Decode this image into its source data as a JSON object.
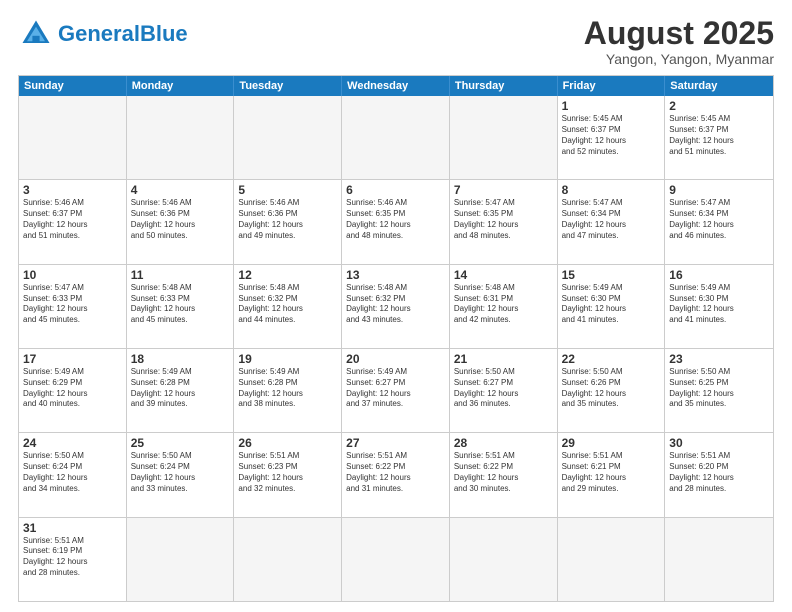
{
  "header": {
    "logo_general": "General",
    "logo_blue": "Blue",
    "month_title": "August 2025",
    "location": "Yangon, Yangon, Myanmar"
  },
  "weekdays": [
    "Sunday",
    "Monday",
    "Tuesday",
    "Wednesday",
    "Thursday",
    "Friday",
    "Saturday"
  ],
  "weeks": [
    [
      {
        "day": "",
        "info": "",
        "empty": true
      },
      {
        "day": "",
        "info": "",
        "empty": true
      },
      {
        "day": "",
        "info": "",
        "empty": true
      },
      {
        "day": "",
        "info": "",
        "empty": true
      },
      {
        "day": "",
        "info": "",
        "empty": true
      },
      {
        "day": "1",
        "info": "Sunrise: 5:45 AM\nSunset: 6:37 PM\nDaylight: 12 hours\nand 52 minutes."
      },
      {
        "day": "2",
        "info": "Sunrise: 5:45 AM\nSunset: 6:37 PM\nDaylight: 12 hours\nand 51 minutes."
      }
    ],
    [
      {
        "day": "3",
        "info": "Sunrise: 5:46 AM\nSunset: 6:37 PM\nDaylight: 12 hours\nand 51 minutes."
      },
      {
        "day": "4",
        "info": "Sunrise: 5:46 AM\nSunset: 6:36 PM\nDaylight: 12 hours\nand 50 minutes."
      },
      {
        "day": "5",
        "info": "Sunrise: 5:46 AM\nSunset: 6:36 PM\nDaylight: 12 hours\nand 49 minutes."
      },
      {
        "day": "6",
        "info": "Sunrise: 5:46 AM\nSunset: 6:35 PM\nDaylight: 12 hours\nand 48 minutes."
      },
      {
        "day": "7",
        "info": "Sunrise: 5:47 AM\nSunset: 6:35 PM\nDaylight: 12 hours\nand 48 minutes."
      },
      {
        "day": "8",
        "info": "Sunrise: 5:47 AM\nSunset: 6:34 PM\nDaylight: 12 hours\nand 47 minutes."
      },
      {
        "day": "9",
        "info": "Sunrise: 5:47 AM\nSunset: 6:34 PM\nDaylight: 12 hours\nand 46 minutes."
      }
    ],
    [
      {
        "day": "10",
        "info": "Sunrise: 5:47 AM\nSunset: 6:33 PM\nDaylight: 12 hours\nand 45 minutes."
      },
      {
        "day": "11",
        "info": "Sunrise: 5:48 AM\nSunset: 6:33 PM\nDaylight: 12 hours\nand 45 minutes."
      },
      {
        "day": "12",
        "info": "Sunrise: 5:48 AM\nSunset: 6:32 PM\nDaylight: 12 hours\nand 44 minutes."
      },
      {
        "day": "13",
        "info": "Sunrise: 5:48 AM\nSunset: 6:32 PM\nDaylight: 12 hours\nand 43 minutes."
      },
      {
        "day": "14",
        "info": "Sunrise: 5:48 AM\nSunset: 6:31 PM\nDaylight: 12 hours\nand 42 minutes."
      },
      {
        "day": "15",
        "info": "Sunrise: 5:49 AM\nSunset: 6:30 PM\nDaylight: 12 hours\nand 41 minutes."
      },
      {
        "day": "16",
        "info": "Sunrise: 5:49 AM\nSunset: 6:30 PM\nDaylight: 12 hours\nand 41 minutes."
      }
    ],
    [
      {
        "day": "17",
        "info": "Sunrise: 5:49 AM\nSunset: 6:29 PM\nDaylight: 12 hours\nand 40 minutes."
      },
      {
        "day": "18",
        "info": "Sunrise: 5:49 AM\nSunset: 6:28 PM\nDaylight: 12 hours\nand 39 minutes."
      },
      {
        "day": "19",
        "info": "Sunrise: 5:49 AM\nSunset: 6:28 PM\nDaylight: 12 hours\nand 38 minutes."
      },
      {
        "day": "20",
        "info": "Sunrise: 5:49 AM\nSunset: 6:27 PM\nDaylight: 12 hours\nand 37 minutes."
      },
      {
        "day": "21",
        "info": "Sunrise: 5:50 AM\nSunset: 6:27 PM\nDaylight: 12 hours\nand 36 minutes."
      },
      {
        "day": "22",
        "info": "Sunrise: 5:50 AM\nSunset: 6:26 PM\nDaylight: 12 hours\nand 35 minutes."
      },
      {
        "day": "23",
        "info": "Sunrise: 5:50 AM\nSunset: 6:25 PM\nDaylight: 12 hours\nand 35 minutes."
      }
    ],
    [
      {
        "day": "24",
        "info": "Sunrise: 5:50 AM\nSunset: 6:24 PM\nDaylight: 12 hours\nand 34 minutes."
      },
      {
        "day": "25",
        "info": "Sunrise: 5:50 AM\nSunset: 6:24 PM\nDaylight: 12 hours\nand 33 minutes."
      },
      {
        "day": "26",
        "info": "Sunrise: 5:51 AM\nSunset: 6:23 PM\nDaylight: 12 hours\nand 32 minutes."
      },
      {
        "day": "27",
        "info": "Sunrise: 5:51 AM\nSunset: 6:22 PM\nDaylight: 12 hours\nand 31 minutes."
      },
      {
        "day": "28",
        "info": "Sunrise: 5:51 AM\nSunset: 6:22 PM\nDaylight: 12 hours\nand 30 minutes."
      },
      {
        "day": "29",
        "info": "Sunrise: 5:51 AM\nSunset: 6:21 PM\nDaylight: 12 hours\nand 29 minutes."
      },
      {
        "day": "30",
        "info": "Sunrise: 5:51 AM\nSunset: 6:20 PM\nDaylight: 12 hours\nand 28 minutes."
      }
    ],
    [
      {
        "day": "31",
        "info": "Sunrise: 5:51 AM\nSunset: 6:19 PM\nDaylight: 12 hours\nand 28 minutes."
      },
      {
        "day": "",
        "info": "",
        "empty": true
      },
      {
        "day": "",
        "info": "",
        "empty": true
      },
      {
        "day": "",
        "info": "",
        "empty": true
      },
      {
        "day": "",
        "info": "",
        "empty": true
      },
      {
        "day": "",
        "info": "",
        "empty": true
      },
      {
        "day": "",
        "info": "",
        "empty": true
      }
    ]
  ]
}
